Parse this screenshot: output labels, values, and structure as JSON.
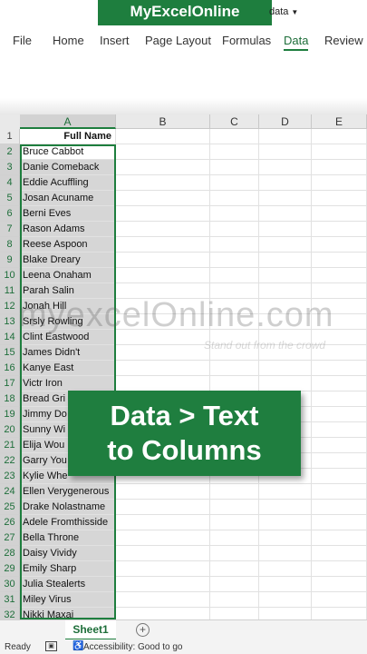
{
  "brand": "MyExcelOnline",
  "file_menu_partial": "data",
  "tabs": [
    "File",
    "Home",
    "Insert",
    "Page Layout",
    "Formulas",
    "Data",
    "Review"
  ],
  "active_tab": "Data",
  "columns": [
    "A",
    "B",
    "C",
    "D",
    "E"
  ],
  "selected_column": "A",
  "rows": [
    {
      "num": "1",
      "a": "Full Name"
    },
    {
      "num": "2",
      "a": "Bruce Cabbot"
    },
    {
      "num": "3",
      "a": "Danie Comeback"
    },
    {
      "num": "4",
      "a": "Eddie Acuffling"
    },
    {
      "num": "5",
      "a": "Josan Acuname"
    },
    {
      "num": "6",
      "a": "Berni Eves"
    },
    {
      "num": "7",
      "a": "Rason Adams"
    },
    {
      "num": "8",
      "a": "Reese Aspoon"
    },
    {
      "num": "9",
      "a": "Blake Dreary"
    },
    {
      "num": "10",
      "a": "Leena Onaham"
    },
    {
      "num": "11",
      "a": "Parah Salin"
    },
    {
      "num": "12",
      "a": "Jonah Hill"
    },
    {
      "num": "13",
      "a": "Srsly Rowling"
    },
    {
      "num": "14",
      "a": "Clint Eastwood"
    },
    {
      "num": "15",
      "a": "James Didn't"
    },
    {
      "num": "16",
      "a": "Kanye East"
    },
    {
      "num": "17",
      "a": "Victr Iron"
    },
    {
      "num": "18",
      "a": "Bread Gri"
    },
    {
      "num": "19",
      "a": "Jimmy Do"
    },
    {
      "num": "20",
      "a": "Sunny Wi"
    },
    {
      "num": "21",
      "a": "Elija Wou"
    },
    {
      "num": "22",
      "a": "Garry You"
    },
    {
      "num": "23",
      "a": "Kylie Whe"
    },
    {
      "num": "24",
      "a": "Ellen Verygenerous"
    },
    {
      "num": "25",
      "a": "Drake Nolastname"
    },
    {
      "num": "26",
      "a": "Adele Fromthisside"
    },
    {
      "num": "27",
      "a": "Bella Throne"
    },
    {
      "num": "28",
      "a": "Daisy Vividy"
    },
    {
      "num": "29",
      "a": "Emily Sharp"
    },
    {
      "num": "30",
      "a": "Julia Stealerts"
    },
    {
      "num": "31",
      "a": "Miley Virus"
    },
    {
      "num": "32",
      "a": "Nikki Maxaj"
    }
  ],
  "watermark": {
    "text": "myexcelOnline.com",
    "tagline": "Stand out from the crowd"
  },
  "callout": {
    "line1": "Data > Text",
    "line2": "to Columns"
  },
  "sheet_tab": "Sheet1",
  "add_sheet": "+",
  "status": {
    "ready": "Ready",
    "accessibility": "Accessibility: Good to go"
  },
  "colors": {
    "accent": "#1e7e3e",
    "selection": "#d6d6d6"
  }
}
